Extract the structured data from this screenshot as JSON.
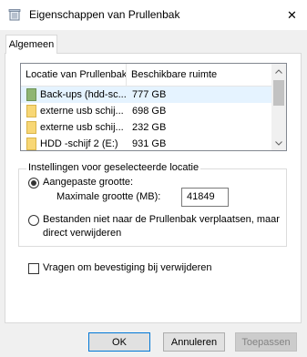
{
  "window": {
    "title": "Eigenschappen van Prullenbak",
    "close_glyph": "✕"
  },
  "tabs": [
    {
      "label": "Algemeen",
      "active": true
    }
  ],
  "location_list": {
    "columns": [
      "Locatie van Prullenbak",
      "Beschikbare ruimte"
    ],
    "rows": [
      {
        "name": "Back-ups (hdd-sc...",
        "space": "777 GB",
        "icon": "drive-green-icon",
        "selected": true
      },
      {
        "name": "externe usb schij...",
        "space": "698 GB",
        "icon": "drive-folder-icon",
        "selected": false
      },
      {
        "name": "externe usb schij...",
        "space": "232 GB",
        "icon": "drive-folder-icon",
        "selected": false
      },
      {
        "name": "HDD -schijf 2 (E:)",
        "space": "931 GB",
        "icon": "drive-folder-icon",
        "selected": false
      }
    ]
  },
  "settings_group": {
    "legend": "Instellingen voor geselecteerde locatie",
    "custom_size": {
      "label": "Aangepaste grootte:",
      "checked": true,
      "max_label": "Maximale grootte (MB):",
      "max_value": "41849"
    },
    "delete_immediately": {
      "label_line1": "Bestanden niet naar de Prullenbak verplaatsen, maar",
      "label_line2": "direct verwijderen",
      "checked": false
    }
  },
  "confirm_delete": {
    "label": "Vragen om bevestiging bij verwijderen",
    "checked": false
  },
  "buttons": {
    "ok": "OK",
    "cancel": "Annuleren",
    "apply": "Toepassen"
  },
  "colors": {
    "selection": "#e5f3ff",
    "folder": "#f8d775",
    "drive_green": "#8fb573",
    "accent": "#0078d7"
  }
}
